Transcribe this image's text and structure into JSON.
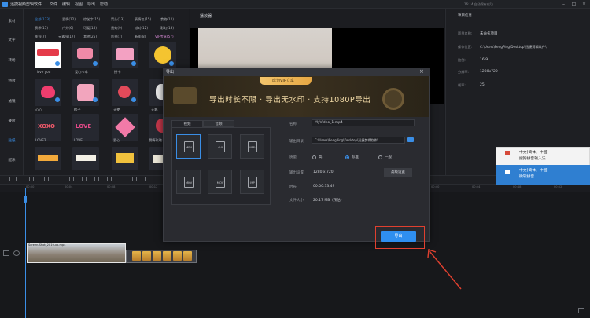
{
  "titlebar": {
    "app_title": "迅捷视频剪辑软件",
    "menu": [
      "文件",
      "编辑",
      "视图",
      "导出",
      "帮助"
    ],
    "autosave": "16:14 自动保存成功",
    "win_buttons": [
      "–",
      "□",
      "×"
    ]
  },
  "leftnav": {
    "items": [
      "素材",
      "文字",
      "转场",
      "特效",
      "滤镜",
      "叠附",
      "贴纸",
      "配乐"
    ],
    "active_index": 6
  },
  "library": {
    "categories_row1": [
      "全部(173)",
      "爱情(12)",
      "综艺字(15)",
      "箭头(13)",
      "表情包(15)",
      "食物(12)"
    ],
    "categories_row2": [
      "表示(15)",
      "户外(6)",
      "可爱(15)",
      "霓虹(9)",
      "派对(12)",
      "彩虹(13)"
    ],
    "categories_row3": [
      "季节(7)",
      "元素节(17)",
      "其他(25)",
      "影视(7)",
      "新年(8)",
      "VIP专享(57)"
    ],
    "stickers_row1": [
      "I love you",
      "爱心卡车",
      "",
      "接书",
      ""
    ],
    "stickers_row2": [
      "心心",
      "",
      "樱子",
      "天使",
      "天鹅"
    ],
    "stickers_row3": [
      "LOVE2",
      "LOVE",
      "",
      "爱心",
      "赞情玫瑰"
    ],
    "sticker_texts": {
      "xoxo": "XOXO",
      "love": "LOVE"
    }
  },
  "player": {
    "title": "播放器"
  },
  "project_info": {
    "title": "项目信息",
    "fields": [
      {
        "k": "项目名称:",
        "v": "未命名项目"
      },
      {
        "k": "保存位置:",
        "v": "C:\\Users\\FengPing\\Desktop\\迅捷剪辑软件\\"
      },
      {
        "k": "比例:",
        "v": "16:9"
      },
      {
        "k": "分辨率:",
        "v": "1280x720"
      },
      {
        "k": "帧率:",
        "v": "25"
      }
    ]
  },
  "ime": {
    "item1_line1": "中文(简体，中国)",
    "item1_line2": "搜狗拼音输入法",
    "item2_line1": "中文(简体，中国)",
    "item2_line2": "微软拼音"
  },
  "timeline": {
    "ticks": [
      "00:00",
      "00:04",
      "00:08",
      "00:12",
      "00:16",
      "00:20",
      "00:24",
      "00:28",
      "00:32",
      "00:36",
      "00:40",
      "00:44",
      "00:48",
      "00:52"
    ],
    "clip1_label": "Screen-Shot_2019-xx.mp4"
  },
  "modal": {
    "title": "导出",
    "vip_pill": "成为VIP立享",
    "banner_text": "导出时长不限 · 导出无水印 · 支持1080P导出",
    "tabs": [
      "视频",
      "音频"
    ],
    "formats": [
      "MP4",
      "AVI",
      "WMV",
      "MKV",
      "MOV",
      "MP"
    ],
    "selected_format": "MP4",
    "fields": {
      "name_label": "名称",
      "name_value": "MyVideo_1.mp4",
      "dir_label": "输出目录",
      "dir_value": "C:\\Users\\FengPing\\Desktop\\迅捷剪辑软件\\",
      "quality_label": "质量",
      "quality_options": [
        "高",
        "标准",
        "一般"
      ],
      "quality_selected": "标准",
      "res_label": "输出设置",
      "res_value": "1280 x 720",
      "adv_button": "高级设置",
      "duration_label": "时长",
      "duration_value": "00:00:33.49",
      "size_label": "文件大小",
      "size_value": "20.17 MB（预估）"
    },
    "export_button": "导出"
  }
}
